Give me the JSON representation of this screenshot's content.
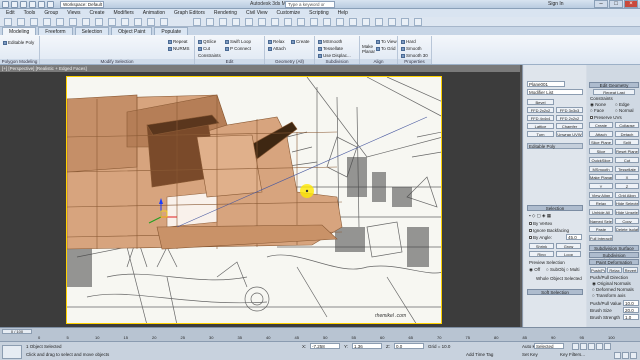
{
  "titlebar": {
    "workspace": "Workspace: Default",
    "document": "Autodesk 3ds Max 2014",
    "search_placeholder": "Type a keyword or phrase",
    "signin": "Sign In"
  },
  "menu": [
    "Edit",
    "Tools",
    "Group",
    "Views",
    "Create",
    "Modifiers",
    "Animation",
    "Graph Editors",
    "Rendering",
    "Civil View",
    "Customize",
    "Scripting",
    "Help"
  ],
  "ribbon_tabs": [
    "Modeling",
    "Freeform",
    "Selection",
    "Object Paint",
    "Populate"
  ],
  "ribbon_groups": {
    "polygon_modeling": {
      "label": "Polygon Modeling",
      "item": "Editable Poly"
    },
    "modify_selection": {
      "label": "Modify Selection",
      "items": [
        "Repeat",
        "Grow",
        "NURMS",
        "Loop",
        "Ring"
      ]
    },
    "edit": {
      "label": "Edit",
      "items": [
        "QSlice",
        "Swift Loop",
        "Cut",
        "P Connect",
        "Constraints"
      ]
    },
    "geometry": {
      "label": "Geometry (All)",
      "items": [
        "Relax",
        "Create",
        "Attach"
      ]
    },
    "subdivision": {
      "label": "Subdivision",
      "items": [
        "MSmooth",
        "Tessellate",
        "Use Displac..."
      ]
    },
    "align": {
      "label": "Align",
      "items": [
        "Make Planar",
        "To View",
        "To Grid"
      ]
    },
    "properties": {
      "label": "Properties",
      "items": [
        "Hard",
        "Smooth",
        "Smooth 30"
      ]
    }
  },
  "viewport": {
    "label": "[+] [Perspective] [Realistic + Edged Faces]",
    "watermark": "rhemikel .com"
  },
  "right_panel": {
    "object_name": "Plane001",
    "modifier_list": "Modifier List",
    "stack_item": "Editable Poly",
    "side_buttons": [
      "Bevel",
      "FFD 2x2x2",
      "FFD 3x3x3",
      "FFD 4x4x4",
      "FFD 2x2x2",
      "Lattice",
      "Chamfer",
      "Turn",
      "Unwrap UVW"
    ],
    "rollout_edit_geometry": "Edit Geometry",
    "repeat_last": "Repeat Last",
    "constraints": [
      "None",
      "Edge",
      "Face",
      "Normal"
    ],
    "preserve_uvs": "Preserve UVs",
    "buttons": [
      "Create",
      "Collapse",
      "Attach",
      "Detach",
      "Slice Plane",
      "Split",
      "Slice",
      "Reset Plane",
      "QuickSlice",
      "Cut",
      "MSmooth",
      "Tessellate",
      "Make Planar",
      "X",
      "Y",
      "Z",
      "View Align",
      "Grid Align",
      "Relax",
      "Hide Selected",
      "Unhide All",
      "Hide Unselected",
      "Named Selections:",
      "Copy",
      "Paste",
      "Delete Isolated Vertices",
      "Full Interactivity"
    ],
    "selection_head": "Selection",
    "by_vertex": "By Vertex",
    "ignore_backfacing": "Ignore Backfacing",
    "by_angle": "By Angle:",
    "angle_value": "45.0",
    "shrink": "Shrink",
    "grow": "Grow",
    "ring": "Ring",
    "loop": "Loop",
    "preview_selection": "Preview Selection",
    "preview_options": [
      "Off",
      "SubObj",
      "Multi"
    ],
    "whole_object": "Whole Object Selected",
    "soft_selection": "Soft Selection",
    "subdivision_surface": "Subdivision Surface",
    "subdivision_displacement": "Subdivision Displacement",
    "paint_deformation": "Paint Deformation",
    "pushpull": "Push/Pull",
    "relax": "Relax",
    "revert": "Revert",
    "pushpull_direction": "Push/Pull Direction",
    "direction_options": [
      "Original Normals",
      "Deformed Normals",
      "Transform axis"
    ],
    "pushpull_value_label": "Push/Pull Value",
    "pushpull_value": "10.0",
    "brush_size_label": "Brush Size",
    "brush_size": "20.0",
    "brush_strength_label": "Brush Strength",
    "brush_strength": "1.0"
  },
  "timeline": {
    "frame": "0 / 100",
    "ticks": [
      "0",
      "5",
      "10",
      "15",
      "20",
      "25",
      "30",
      "35",
      "40",
      "45",
      "50",
      "55",
      "60",
      "65",
      "70",
      "75",
      "80",
      "85",
      "90",
      "95",
      "100"
    ]
  },
  "statusbar": {
    "objects_selected": "1 Object Selected",
    "prompt": "Click and drag to select and move objects",
    "x_label": "X:",
    "x_value": "-7.258",
    "y_label": "Y:",
    "y_value": "1.36",
    "z_label": "Z:",
    "z_value": "0.0",
    "grid": "Grid = 10.0",
    "add_time_tag": "Add Time Tag",
    "auto_key": "Auto Key",
    "set_key": "Set Key",
    "selected": "Selected",
    "key_filters": "Key Filters..."
  }
}
